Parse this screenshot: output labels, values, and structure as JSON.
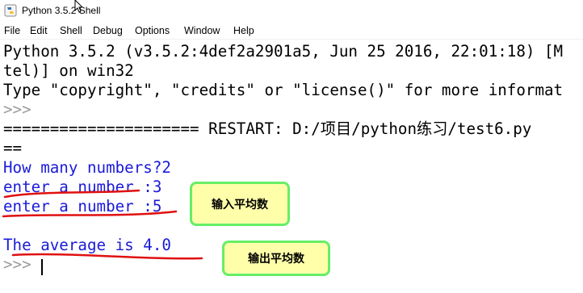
{
  "window": {
    "title": "Python 3.5.2 Shell",
    "icon": "python-icon"
  },
  "menu": {
    "items": [
      "File",
      "Edit",
      "Shell",
      "Debug",
      "Options",
      "Window",
      "Help"
    ]
  },
  "shell": {
    "banner_line1": "Python 3.5.2 (v3.5.2:4def2a2901a5, Jun 25 2016, 22:01:18) [M",
    "banner_line2": "tel)] on win32",
    "banner_line3": "Type \"copyright\", \"credits\" or \"license()\" for more informat",
    "prompt": ">>>",
    "restart_line": "===================== RESTART: D:/项目/python练习/test6.py",
    "restart_tail": "==",
    "output_lines": [
      "How many numbers?2",
      "enter a number :3",
      "enter a number :5"
    ],
    "blank_line": "",
    "average_line": "The average is 4.0",
    "final_prompt": ">>>"
  },
  "annotations": {
    "input_note": "输入平均数",
    "output_note": "输出平均数"
  },
  "colors": {
    "stdout_blue": "#1a1ad8",
    "prompt_gray": "#9c9c9c",
    "underline_red": "#e01010",
    "note_bg": "#ffffaa",
    "note_border": "#66ee66"
  }
}
